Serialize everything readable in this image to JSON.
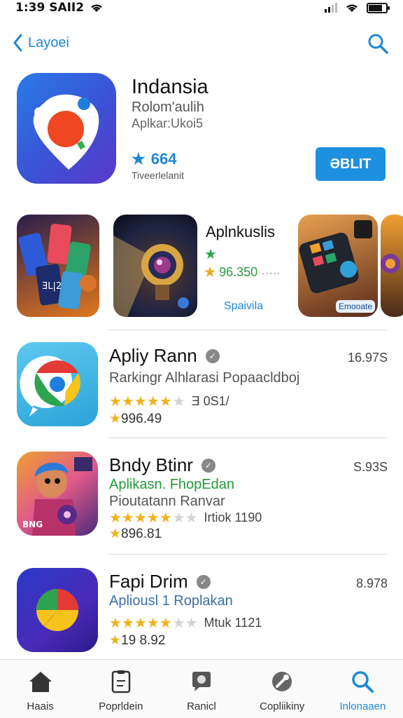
{
  "status_bar": {
    "time": "1:39 SAII2"
  },
  "nav": {
    "back_label": "Layoei"
  },
  "hero": {
    "title": "Indansia",
    "subtitle": "Rolom'aulih",
    "category": "Aplkar:Ukoi5",
    "rating": "664",
    "rating_label": "Tiveerlelanit",
    "get_label": "ƏBLIT"
  },
  "screenshots": {
    "card_title": "Aplnkuslis",
    "card_star": "★",
    "card_rating": "96.350",
    "card_dots": ".....",
    "card_link": "Spaivila",
    "shot3_label": "Emooate",
    "shot1_text": "ƎL|2"
  },
  "apps": [
    {
      "name": "Apliy Rann",
      "size": "16.97S",
      "line1": "Rarkingr Alhlarasi Popaacldboj",
      "stars_count": "Ǝ 0S1/",
      "score": "996.49"
    },
    {
      "name": "Bndy Btinr",
      "size": "S.93S",
      "line1": "Aplikasn. FhopEdan",
      "line2": "Pioutatann Ranvar",
      "stars_count": "Irtiok 1190",
      "score": "896.81",
      "icon_text": "BNG"
    },
    {
      "name": "Fapi Drim",
      "size": "8.978",
      "line1": "Apliousl 1 Roplakan",
      "stars_count": "Mtuk 1121",
      "score": "19 8.92"
    }
  ],
  "tabs": [
    {
      "label": "Haais",
      "icon": "home-icon"
    },
    {
      "label": "Poprldein",
      "icon": "document-icon"
    },
    {
      "label": "Ranicl",
      "icon": "chat-icon"
    },
    {
      "label": "Copliikiny",
      "icon": "tools-icon"
    },
    {
      "label": "Inlonaaen",
      "icon": "search-icon",
      "active": true
    }
  ],
  "colors": {
    "accent": "#1e88d6",
    "star": "#f0b21c",
    "green": "#249a3a"
  }
}
